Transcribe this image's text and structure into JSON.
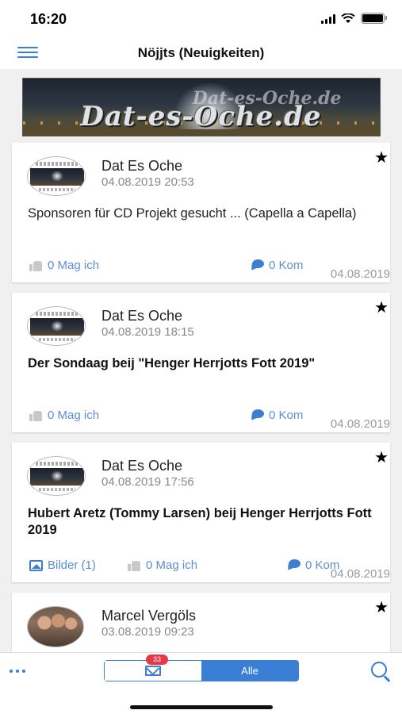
{
  "status_bar": {
    "time": "16:20"
  },
  "header": {
    "title": "Nöjjts (Neuigkeiten)"
  },
  "banner": {
    "text": "Dat-es-Oche.de"
  },
  "posts": [
    {
      "author": "Dat Es Oche",
      "datetime": "04.08.2019 20:53",
      "text": "Sponsoren für CD Projekt gesucht ... (Capella a Capella)",
      "like_label": "0 Mag ich",
      "comment_label": "0 Kom",
      "date": "04.08.2019"
    },
    {
      "author": "Dat Es Oche",
      "datetime": "04.08.2019 18:15",
      "text": "Der Sondaag beij \"Henger Herrjotts Fott 2019\"",
      "like_label": "0 Mag ich",
      "comment_label": "0 Kom",
      "date": "04.08.2019"
    },
    {
      "author": "Dat Es Oche",
      "datetime": "04.08.2019 17:56",
      "text": "Hubert Aretz (Tommy Larsen) beij Henger Herrjotts Fott 2019",
      "images_label": "Bilder (1)",
      "like_label": "0 Mag ich",
      "comment_label": "0 Kom",
      "date": "04.08.2019"
    },
    {
      "author": "Marcel Vergöls",
      "datetime": "03.08.2019 09:23"
    }
  ],
  "bottom_bar": {
    "badge_count": "33",
    "all_label": "Alle"
  },
  "colors": {
    "accent": "#3a7fd5",
    "badge": "#e53945"
  }
}
